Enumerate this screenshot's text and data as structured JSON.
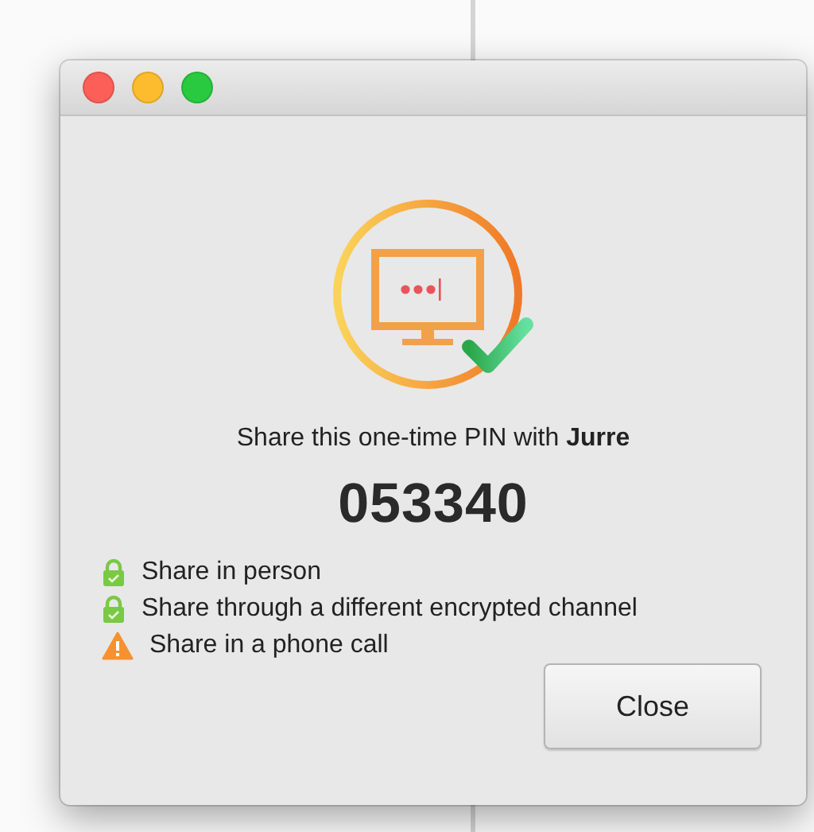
{
  "message": "Share this one-time PIN with **Jurre**",
  "pin": "053340",
  "options": [
    {
      "kind": "secure",
      "label": "Share in person"
    },
    {
      "kind": "secure",
      "label": "Share through a different encrypted channel"
    },
    {
      "kind": "warning",
      "label": "Share in a phone call"
    }
  ],
  "buttons": [
    "Close"
  ]
}
